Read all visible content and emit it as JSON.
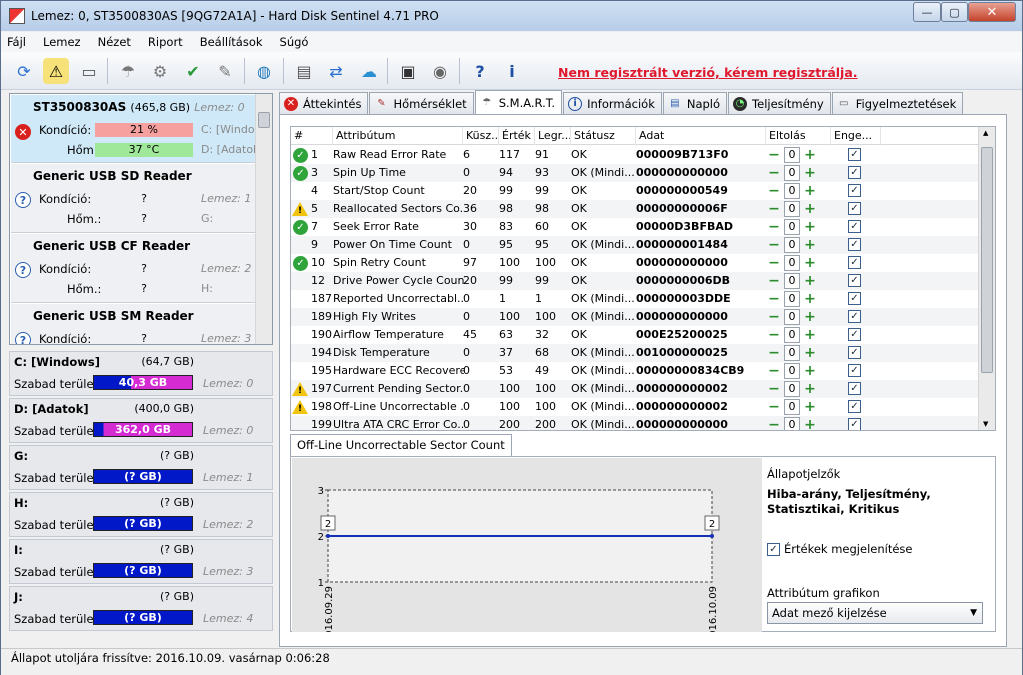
{
  "window": {
    "title": "Lemez: 0, ST3500830AS [9QG72A1A]  -  Hard Disk Sentinel 4.71 PRO",
    "controls": {
      "minimize": "—",
      "maximize": "▢",
      "close": "✕"
    }
  },
  "menu": [
    "Fájl",
    "Lemez",
    "Nézet",
    "Riport",
    "Beállítások",
    "Súgó"
  ],
  "register_link": "Nem regisztrált verzió, kérem regisztrálja.",
  "disks": [
    {
      "name": "ST3500830AS",
      "size": "(465,8 GB)",
      "disk": "Lemez: 0",
      "cond_label": "Kondíció:",
      "cond_value": "21 %",
      "temp_label": "Hőm.:",
      "temp_value": "37 °C",
      "part1": "C: [Windows]",
      "part2": "D: [Adatok]",
      "status": "error"
    },
    {
      "name": "Generic USB SD Reader",
      "size": "",
      "disk": "Lemez: 1",
      "cond_label": "Kondíció:",
      "cond_value": "?",
      "temp_label": "Hőm.:",
      "temp_value": "?",
      "part1": "",
      "part2": "G:",
      "status": "unknown"
    },
    {
      "name": "Generic USB CF Reader",
      "size": "",
      "disk": "Lemez: 2",
      "cond_label": "Kondíció:",
      "cond_value": "?",
      "temp_label": "Hőm.:",
      "temp_value": "?",
      "part1": "",
      "part2": "H:",
      "status": "unknown"
    },
    {
      "name": "Generic USB SM Reader",
      "size": "",
      "disk": "Lemez: 3",
      "cond_label": "Kondíció:",
      "cond_value": "?",
      "temp_label": "",
      "temp_value": "",
      "part1": "",
      "part2": "",
      "status": "unknown"
    }
  ],
  "partitions": [
    {
      "name": "C: [Windows]",
      "size": "(64,7 GB)",
      "free_label": "Szabad terület",
      "free": "40,3 GB",
      "free_frac": 0.623,
      "disk": "Lemez: 0"
    },
    {
      "name": "D: [Adatok]",
      "size": "(400,0 GB)",
      "free_label": "Szabad terület",
      "free": "362,0 GB",
      "free_frac": 0.905,
      "disk": "Lemez: 0"
    },
    {
      "name": "G:",
      "size": "(? GB)",
      "free_label": "Szabad terület",
      "free": "(? GB)",
      "free_frac": 0,
      "disk": "Lemez: 1"
    },
    {
      "name": "H:",
      "size": "(? GB)",
      "free_label": "Szabad terület",
      "free": "(? GB)",
      "free_frac": 0,
      "disk": "Lemez: 2"
    },
    {
      "name": "I:",
      "size": "(? GB)",
      "free_label": "Szabad terület",
      "free": "(? GB)",
      "free_frac": 0,
      "disk": "Lemez: 3"
    },
    {
      "name": "J:",
      "size": "(? GB)",
      "free_label": "Szabad terület",
      "free": "(? GB)",
      "free_frac": 0,
      "disk": "Lemez: 4"
    }
  ],
  "tabs": [
    {
      "label": "Áttekintés",
      "icon": "error-icon",
      "active": false
    },
    {
      "label": "Hőmérséklet",
      "icon": "thermometer-icon",
      "active": false
    },
    {
      "label": "S.M.A.R.T.",
      "icon": "smart-icon",
      "active": true
    },
    {
      "label": "Információk",
      "icon": "info-icon",
      "active": false
    },
    {
      "label": "Napló",
      "icon": "log-icon",
      "active": false
    },
    {
      "label": "Teljesítmény",
      "icon": "performance-icon",
      "active": false
    },
    {
      "label": "Figyelmeztetések",
      "icon": "alerts-icon",
      "active": false
    }
  ],
  "smart": {
    "headers": [
      "#",
      "Attribútum",
      "Küsz...",
      "Érték",
      "Legr...",
      "Státusz",
      "Adat",
      "Eltolás",
      "Enge..."
    ],
    "rows": [
      {
        "status": "ok",
        "num": "1",
        "attr": "Raw Read Error Rate",
        "thr": "6",
        "val": "117",
        "worst": "91",
        "st": "OK",
        "data": "000009B713F0",
        "offset": "0"
      },
      {
        "status": "ok",
        "num": "3",
        "attr": "Spin Up Time",
        "thr": "0",
        "val": "94",
        "worst": "93",
        "st": "OK (Mindi...",
        "data": "000000000000",
        "offset": "0"
      },
      {
        "status": "",
        "num": "4",
        "attr": "Start/Stop Count",
        "thr": "20",
        "val": "99",
        "worst": "99",
        "st": "OK",
        "data": "000000000549",
        "offset": "0"
      },
      {
        "status": "warn",
        "num": "5",
        "attr": "Reallocated Sectors Co...",
        "thr": "36",
        "val": "98",
        "worst": "98",
        "st": "OK",
        "data": "00000000006F",
        "offset": "0"
      },
      {
        "status": "ok",
        "num": "7",
        "attr": "Seek Error Rate",
        "thr": "30",
        "val": "83",
        "worst": "60",
        "st": "OK",
        "data": "00000D3BFBAD",
        "offset": "0"
      },
      {
        "status": "",
        "num": "9",
        "attr": "Power On Time Count",
        "thr": "0",
        "val": "95",
        "worst": "95",
        "st": "OK (Mindi...",
        "data": "000000001484",
        "offset": "0"
      },
      {
        "status": "ok",
        "num": "10",
        "attr": "Spin Retry Count",
        "thr": "97",
        "val": "100",
        "worst": "100",
        "st": "OK",
        "data": "000000000000",
        "offset": "0"
      },
      {
        "status": "",
        "num": "12",
        "attr": "Drive Power Cycle Count",
        "thr": "20",
        "val": "99",
        "worst": "99",
        "st": "OK",
        "data": "0000000006DB",
        "offset": "0"
      },
      {
        "status": "",
        "num": "187",
        "attr": "Reported Uncorrectabl...",
        "thr": "0",
        "val": "1",
        "worst": "1",
        "st": "OK (Mindi...",
        "data": "000000003DDE",
        "offset": "0"
      },
      {
        "status": "",
        "num": "189",
        "attr": "High Fly Writes",
        "thr": "0",
        "val": "100",
        "worst": "100",
        "st": "OK (Mindi...",
        "data": "000000000000",
        "offset": "0"
      },
      {
        "status": "",
        "num": "190",
        "attr": "Airflow Temperature",
        "thr": "45",
        "val": "63",
        "worst": "32",
        "st": "OK",
        "data": "000E25200025",
        "offset": "0"
      },
      {
        "status": "",
        "num": "194",
        "attr": "Disk Temperature",
        "thr": "0",
        "val": "37",
        "worst": "68",
        "st": "OK (Mindi...",
        "data": "001000000025",
        "offset": "0"
      },
      {
        "status": "",
        "num": "195",
        "attr": "Hardware ECC Recovered",
        "thr": "0",
        "val": "53",
        "worst": "49",
        "st": "OK (Mindi...",
        "data": "00000000834CB9",
        "offset": "0"
      },
      {
        "status": "warn",
        "num": "197",
        "attr": "Current Pending Sector...",
        "thr": "0",
        "val": "100",
        "worst": "100",
        "st": "OK (Mindi...",
        "data": "000000000002",
        "offset": "0"
      },
      {
        "status": "warn",
        "num": "198",
        "attr": "Off-Line Uncorrectable ...",
        "thr": "0",
        "val": "100",
        "worst": "100",
        "st": "OK (Mindi...",
        "data": "000000000002",
        "offset": "0"
      },
      {
        "status": "",
        "num": "199",
        "attr": "Ultra ATA CRC Error Co...",
        "thr": "0",
        "val": "200",
        "worst": "200",
        "st": "OK (Mindi...",
        "data": "000000000000",
        "offset": "0"
      }
    ]
  },
  "chart_tab": "Off-Line Uncorrectable Sector Count",
  "chart_data": {
    "type": "line",
    "x": [
      "2016.09.29",
      "2016.10.09"
    ],
    "series": [
      {
        "values": [
          2,
          2
        ]
      }
    ],
    "data_labels": [
      "2",
      "2"
    ],
    "y_ticks": [
      "1",
      "2",
      "3"
    ],
    "ylim": [
      1,
      3
    ],
    "grid": false,
    "title": "",
    "xlabel": "",
    "ylabel": ""
  },
  "info": {
    "header": "Állapotjelzők",
    "body": "Hiba-arány, Teljesítmény, Statisztikai, Kritikus",
    "show_values": "Értékek megjelenítése",
    "attr_graph_label": "Attribútum grafikon",
    "attr_graph_value": "Adat mező kijelzése"
  },
  "statusbar": "Állapot utoljára frissítve: 2016.10.09. vasárnap 0:06:28"
}
